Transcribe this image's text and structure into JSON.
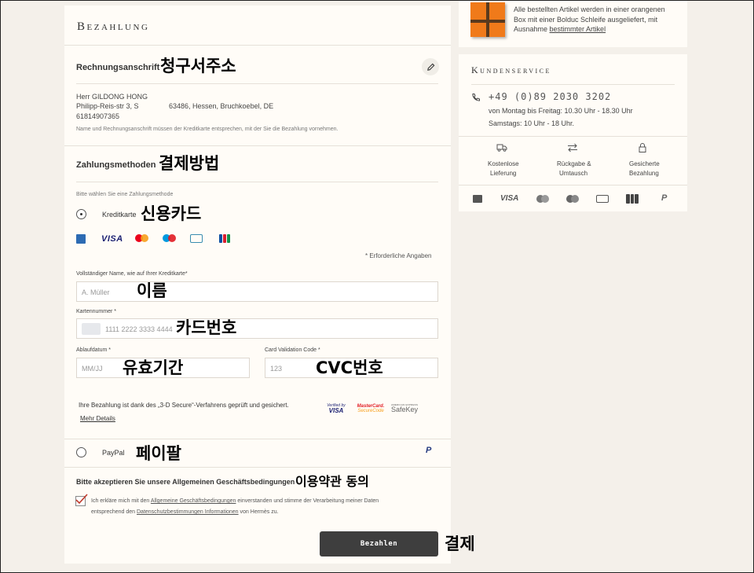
{
  "main": {
    "title": "Bezahlung",
    "billing": {
      "heading": "Rechnungsanschrift",
      "annotation": "청구서주소",
      "name": "Herr GILDONG HONG",
      "address_street": "Philipp-Reis-str 3,  S",
      "address_city": "63486, Hessen, Bruchkoebel,  DE",
      "phone": "61814907365",
      "note": "Name und Rechnungsanschrift müssen der Kreditkarte entsprechen, mit der Sie die Bezahlung vornehmen."
    },
    "payment_methods": {
      "heading": "Zahlungsmethoden",
      "annotation": "결제방법",
      "prompt": "Bitte wählen Sie eine Zahlungsmethode",
      "credit_card_label": "Kreditkarte",
      "credit_card_annotation": "신용카드",
      "visa_logo": "VISA",
      "required_note": "* Erforderliche Angaben",
      "name_label": "Vollständiger Name, wie auf Ihrer Kreditkarte*",
      "name_placeholder": "A. Müller",
      "name_annotation": "이름",
      "card_number_label": "Kartennummer *",
      "card_number_placeholder": "1111 2222 3333 4444",
      "card_number_annotation": "카드번호",
      "expiry_label": "Ablaufdatum *",
      "expiry_placeholder": "MM/JJ",
      "expiry_annotation": "유효기간",
      "cvc_label": "Card Validation Code *",
      "cvc_placeholder": "123",
      "cvc_annotation": "CVC번호",
      "secure_text": "Ihre Bezahlung ist dank des „3-D Secure“-Verfahrens geprüft und gesichert.",
      "more_details": "Mehr Details",
      "verified_by": "Verified by",
      "verified_visa": "VISA",
      "mastercard_line1": "MasterCard.",
      "mastercard_line2": "SecureCode",
      "american_express": "AMERICAN EXPRESS",
      "safekey": "SafeKey",
      "paypal_label": "PayPal",
      "paypal_annotation": "페이팔"
    },
    "terms": {
      "heading": "Bitte akzeptieren Sie unsere Allgemeinen Geschäftsbedingungen",
      "annotation": "이용약관 동의",
      "text_1": "Ich erkläre mich mit den",
      "link_agb": "Allgemeine Geschäftsbedingungen",
      "text_2": "einverstanden und stimme der Verarbeitung meiner Daten",
      "text_3": "entsprechend den",
      "link_privacy": "Datenschutzbestimmungen Informationen",
      "text_4": "von Hermès zu."
    },
    "pay_button": "Bezahlen",
    "pay_annotation": "결제"
  },
  "sidebar": {
    "gift_text_1": "Alle bestellten Artikel werden in einer orangenen",
    "gift_text_2": "Box mit einer Bolduc Schleife ausgeliefert, mit",
    "gift_text_3": "Ausnahme",
    "gift_link": "bestimmter Artikel",
    "service_title": "Kundenservice",
    "phone": "+49 (0)89 2030 3202",
    "hours_weekday": "von Montag bis Freitag: 10.30 Uhr - 18.30 Uhr",
    "hours_saturday": "Samstags: 10 Uhr - 18 Uhr.",
    "features": [
      {
        "line1": "Kostenlose",
        "line2": "Lieferung"
      },
      {
        "line1": "Rückgabe &",
        "line2": "Umtausch"
      },
      {
        "line1": "Gesicherte",
        "line2": "Bezahlung"
      }
    ],
    "visa_logo": "VISA"
  },
  "colors": {
    "background": "#f4f0ea",
    "panel": "#fffcf7",
    "button": "#3e3e3e",
    "orange_box": "#f07a1a",
    "check": "#c0392b"
  }
}
